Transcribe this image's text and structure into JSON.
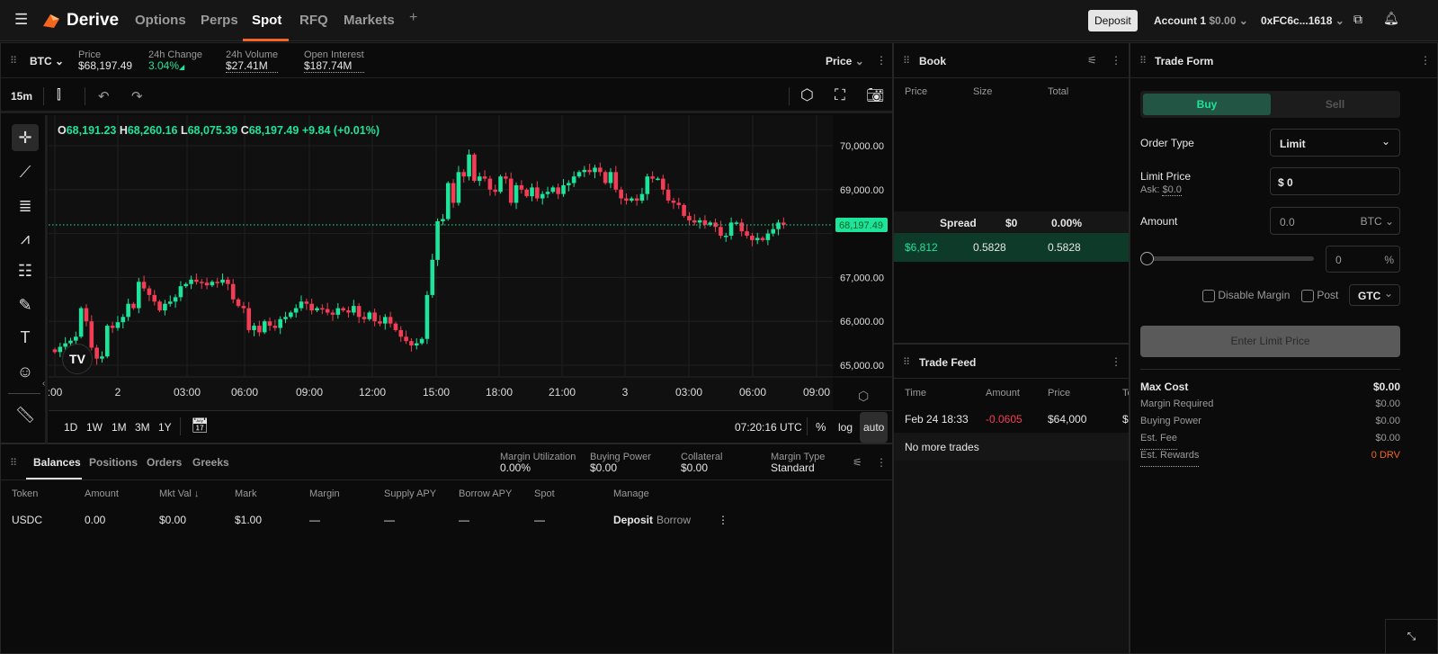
{
  "nav": {
    "brand": "Derive",
    "tabs": [
      "Options",
      "Perps",
      "Spot",
      "RFQ",
      "Markets"
    ],
    "active_tab": "Spot",
    "plus": "+",
    "deposit": "Deposit",
    "account": "Account 1",
    "account_balance": "$0.00",
    "wallet": "0xFC6c...1618"
  },
  "ticker": {
    "symbol": "BTC",
    "price_label": "Price",
    "price": "$68,197.49",
    "change_label": "24h Change",
    "change": "3.04%",
    "volume_label": "24h Volume",
    "volume": "$27.41M",
    "oi_label": "Open Interest",
    "oi": "$187.74M",
    "mode": "Price"
  },
  "chart_toolbar": {
    "interval": "15m"
  },
  "ohlc": {
    "o_label": "O",
    "o": "68,191.23",
    "h_label": "H",
    "h": "68,260.16",
    "l_label": "L",
    "l": "68,075.39",
    "c_label": "C",
    "c": "68,197.49",
    "change": "+9.84 (+0.01%)"
  },
  "chart_bottom": {
    "ranges": [
      "1D",
      "1W",
      "1M",
      "3M",
      "1Y"
    ],
    "clock": "07:20:16 UTC",
    "pct": "%",
    "log": "log",
    "auto": "auto"
  },
  "chart_data": {
    "type": "candlestick",
    "interval": "15m",
    "ylim": [
      64800,
      70300
    ],
    "y_ticks": [
      {
        "v": 70000,
        "label": "70,000.00"
      },
      {
        "v": 69000,
        "label": "69,000.00"
      },
      {
        "v": 67000,
        "label": "67,000.00"
      },
      {
        "v": 66000,
        "label": "66,000.00"
      },
      {
        "v": 65000,
        "label": "65,000.00"
      }
    ],
    "x_ticks": [
      ":00",
      "2",
      "03:00",
      "06:00",
      "09:00",
      "12:00",
      "15:00",
      "18:00",
      "21:00",
      "3",
      "03:00",
      "06:00",
      "09:00"
    ],
    "last_price": 68197.49,
    "last_price_label": "68,197.49",
    "closes": [
      65300,
      65420,
      65500,
      65560,
      65650,
      66300,
      66000,
      65400,
      65150,
      65200,
      65900,
      65850,
      65980,
      66100,
      66400,
      66300,
      66900,
      66750,
      66600,
      66450,
      66250,
      66400,
      66450,
      66550,
      66800,
      66850,
      66950,
      66900,
      66880,
      66820,
      66900,
      66880,
      66950,
      66850,
      66500,
      66350,
      66300,
      65800,
      65900,
      65750,
      66000,
      65900,
      65850,
      66050,
      66100,
      66200,
      66300,
      66450,
      66400,
      66250,
      66300,
      66280,
      66200,
      66150,
      66300,
      66250,
      66200,
      66350,
      66100,
      66050,
      66200,
      66000,
      65950,
      66100,
      65950,
      65800,
      65650,
      65550,
      65450,
      65500,
      65600,
      66600,
      67400,
      68280,
      68330,
      69150,
      68700,
      69400,
      69300,
      69800,
      69200,
      69300,
      69250,
      69000,
      68950,
      69300,
      69250,
      68700,
      69100,
      69000,
      68850,
      69050,
      68800,
      68900,
      68950,
      69050,
      68900,
      69100,
      69150,
      69300,
      69400,
      69450,
      69400,
      69500,
      69400,
      69150,
      69400,
      69000,
      68800,
      68750,
      68800,
      68750,
      68900,
      69300,
      69250,
      69250,
      69000,
      68750,
      68700,
      68650,
      68400,
      68300,
      68250,
      68300,
      68200,
      68250,
      68150,
      67950,
      67950,
      68250,
      68250,
      68050,
      67950,
      67850,
      67900,
      67850,
      68000,
      68100,
      68250,
      68200
    ],
    "up_color": "#1ee39a",
    "down_color": "#f23d55"
  },
  "book": {
    "title": "Book",
    "cols": [
      "Price",
      "Size",
      "Total"
    ],
    "spread_label": "Spread",
    "spread": "$0",
    "spread_pct": "0.00%",
    "bid": {
      "price": "$6,812",
      "size": "0.5828",
      "total": "0.5828"
    }
  },
  "feed": {
    "title": "Trade Feed",
    "cols": [
      "Time",
      "Amount",
      "Price",
      "To"
    ],
    "row": {
      "time": "Feb 24 18:33",
      "amount": "-0.0605",
      "price": "$64,000",
      "total": "$"
    },
    "empty": "No more trades"
  },
  "form": {
    "title": "Trade Form",
    "buy": "Buy",
    "sell": "Sell",
    "order_type_label": "Order Type",
    "order_type": "Limit",
    "limit_label": "Limit Price",
    "ask_label": "Ask:",
    "ask": "$0.0",
    "limit_value": "$ 0",
    "amount_label": "Amount",
    "amount_placeholder": "0.0",
    "amount_unit": "BTC",
    "pct_value": "0",
    "pct_unit": "%",
    "slider_value": 0,
    "disable_margin": "Disable Margin",
    "post": "Post",
    "tif": "GTC",
    "submit": "Enter Limit Price",
    "summary": [
      {
        "label": "Max Cost",
        "value": "$0.00"
      },
      {
        "label": "Margin Required",
        "value": "$0.00"
      },
      {
        "label": "Buying Power",
        "value": "$0.00"
      },
      {
        "label": "Est. Fee",
        "value": "$0.00"
      },
      {
        "label": "Est. Rewards",
        "value": "0 DRV"
      }
    ]
  },
  "balances": {
    "tabs": [
      "Balances",
      "Positions",
      "Orders",
      "Greeks"
    ],
    "stats": [
      {
        "label": "Margin Utilization",
        "value": "0.00%"
      },
      {
        "label": "Buying Power",
        "value": "$0.00"
      },
      {
        "label": "Collateral",
        "value": "$0.00"
      },
      {
        "label": "Margin Type",
        "value": "Standard"
      }
    ],
    "cols": [
      "Token",
      "Amount",
      "Mkt Val ↓",
      "Mark",
      "Margin",
      "Supply APY",
      "Borrow APY",
      "Spot",
      "Manage"
    ],
    "rows": [
      {
        "token": "USDC",
        "amount": "0.00",
        "mkt_val": "$0.00",
        "mark": "$1.00",
        "margin": "—",
        "supply": "—",
        "borrow": "—",
        "spot": "—",
        "deposit": "Deposit",
        "borrow_btn": "Borrow"
      }
    ]
  }
}
